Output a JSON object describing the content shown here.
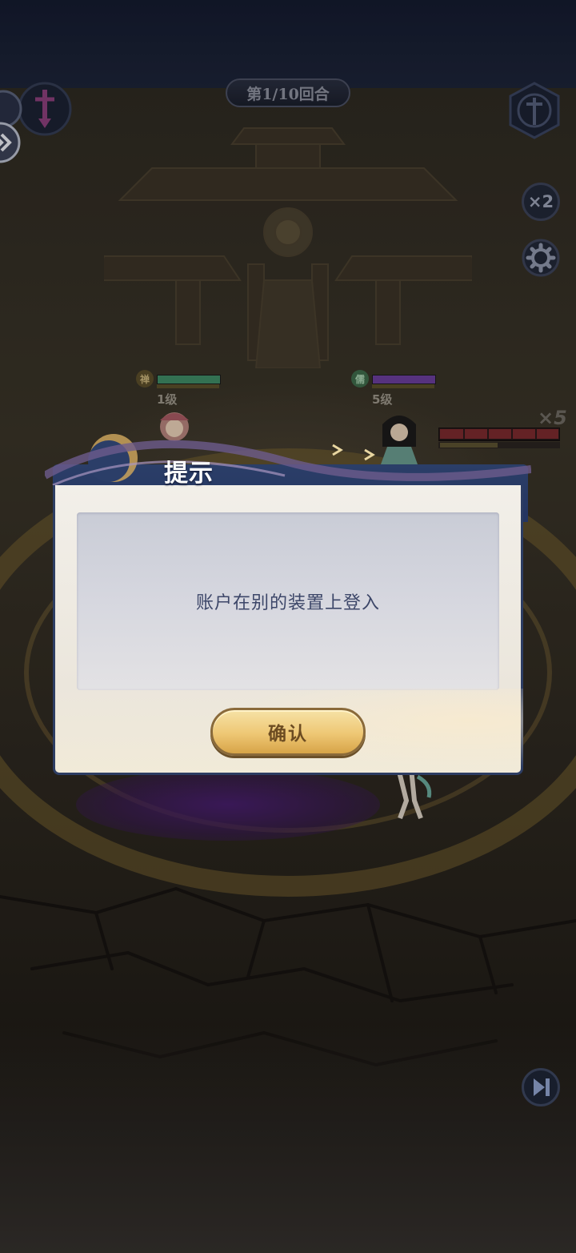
{
  "hud": {
    "round_label": "第1/10回合",
    "speed_label": "×2"
  },
  "units": [
    {
      "level_label": "1级",
      "badge": "禅",
      "bar_color": "#3f8a64"
    },
    {
      "level_label": "5级",
      "badge": "儒",
      "bar_color": "#6a3e9a"
    }
  ],
  "enemy": {
    "multiplier_label": "×5",
    "hp_color": "#8a2a2e"
  },
  "dialog": {
    "title": "提示",
    "message": "账户在别的装置上登入",
    "confirm_label": "确认"
  },
  "colors": {
    "dialog_header": "#2b3e68",
    "confirm_button": "#eec774",
    "message_text": "#3c4668"
  },
  "icons": {
    "left_emblem": "sword-down-icon",
    "right_emblem": "sword-crest-icon",
    "settings": "gear-icon",
    "skip": "skip-forward-icon",
    "side_toggle": "double-chevron-icon"
  }
}
